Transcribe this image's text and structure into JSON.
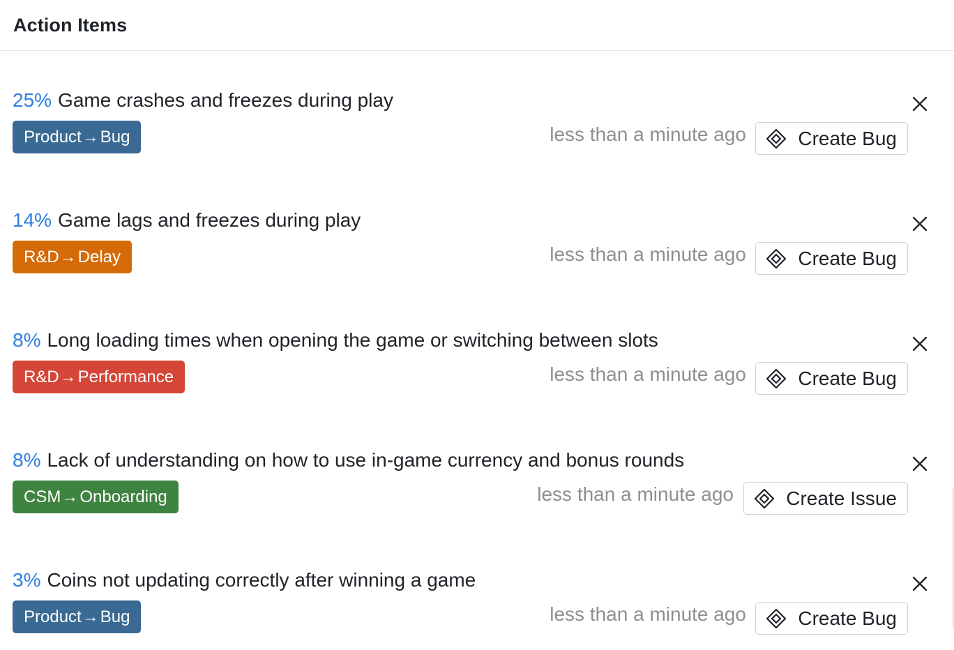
{
  "header": {
    "title": "Action Items"
  },
  "colors": {
    "percent": "#2f7fe0",
    "product_bug": "#3a6a93",
    "rd_delay": "#d46a08",
    "rd_performance": "#d44637",
    "csm_onboarding": "#3f8340"
  },
  "items": [
    {
      "percent": "25%",
      "text": "Game crashes and freezes during play",
      "tag_source": "Product",
      "tag_arrow": "→",
      "tag_target": "Bug",
      "tag_color": "#3a6a93",
      "timestamp": "less than a minute ago",
      "button_label": "Create Bug",
      "button_icon": "jira-diamond-icon",
      "close_icon": "close-icon"
    },
    {
      "percent": "14%",
      "text": "Game lags and freezes during play",
      "tag_source": "R&D",
      "tag_arrow": "→",
      "tag_target": "Delay",
      "tag_color": "#d46a08",
      "timestamp": "less than a minute ago",
      "button_label": "Create Bug",
      "button_icon": "jira-diamond-icon",
      "close_icon": "close-icon"
    },
    {
      "percent": "8%",
      "text": "Long loading times when opening the game or switching between slots",
      "tag_source": "R&D",
      "tag_arrow": "→",
      "tag_target": "Performance",
      "tag_color": "#d44637",
      "timestamp": "less than a minute ago",
      "button_label": "Create Bug",
      "button_icon": "jira-diamond-icon",
      "close_icon": "close-icon"
    },
    {
      "percent": "8%",
      "text": "Lack of understanding on how to use in-game currency and bonus rounds",
      "tag_source": "CSM",
      "tag_arrow": "→",
      "tag_target": "Onboarding",
      "tag_color": "#3f8340",
      "timestamp": "less than a minute ago",
      "button_label": "Create Issue",
      "button_icon": "jira-diamond-icon",
      "close_icon": "close-icon"
    },
    {
      "percent": "3%",
      "text": "Coins not updating correctly after winning a game",
      "tag_source": "Product",
      "tag_arrow": "→",
      "tag_target": "Bug",
      "tag_color": "#3a6a93",
      "timestamp": "less than a minute ago",
      "button_label": "Create Bug",
      "button_icon": "jira-diamond-icon",
      "close_icon": "close-icon"
    }
  ]
}
